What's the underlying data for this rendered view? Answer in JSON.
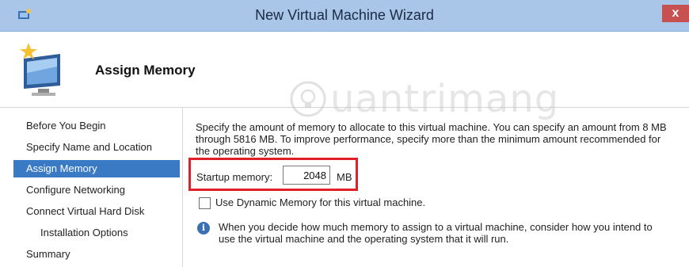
{
  "window": {
    "title": "New Virtual Machine Wizard",
    "close_label": "x"
  },
  "header": {
    "heading": "Assign Memory",
    "icon": "vm-monitor-icon"
  },
  "watermark": {
    "text": "uantrimang",
    "icon": "lightbulb-icon"
  },
  "nav": {
    "items": [
      {
        "label": "Before You Begin"
      },
      {
        "label": "Specify Name and Location"
      },
      {
        "label": "Assign Memory"
      },
      {
        "label": "Configure Networking"
      },
      {
        "label": "Connect Virtual Hard Disk"
      },
      {
        "label": "Installation Options"
      },
      {
        "label": "Summary"
      }
    ],
    "active_index": 2
  },
  "content": {
    "description": "Specify the amount of memory to allocate to this virtual machine. You can specify an amount from 8 MB through 5816 MB. To improve performance, specify more than the minimum amount recommended for the operating system.",
    "startup_label": "Startup memory:",
    "startup_value": "2048",
    "unit": "MB",
    "dynamic_memory_label": "Use Dynamic Memory for this virtual machine.",
    "dynamic_memory_checked": false,
    "info_text": "When you decide how much memory to assign to a virtual machine, consider how you intend to use the virtual machine and the operating system that it will run."
  },
  "colors": {
    "titlebar": "#a9c6e8",
    "nav_active": "#3a79c4",
    "highlight": "#e2202a",
    "close": "#c75050"
  }
}
